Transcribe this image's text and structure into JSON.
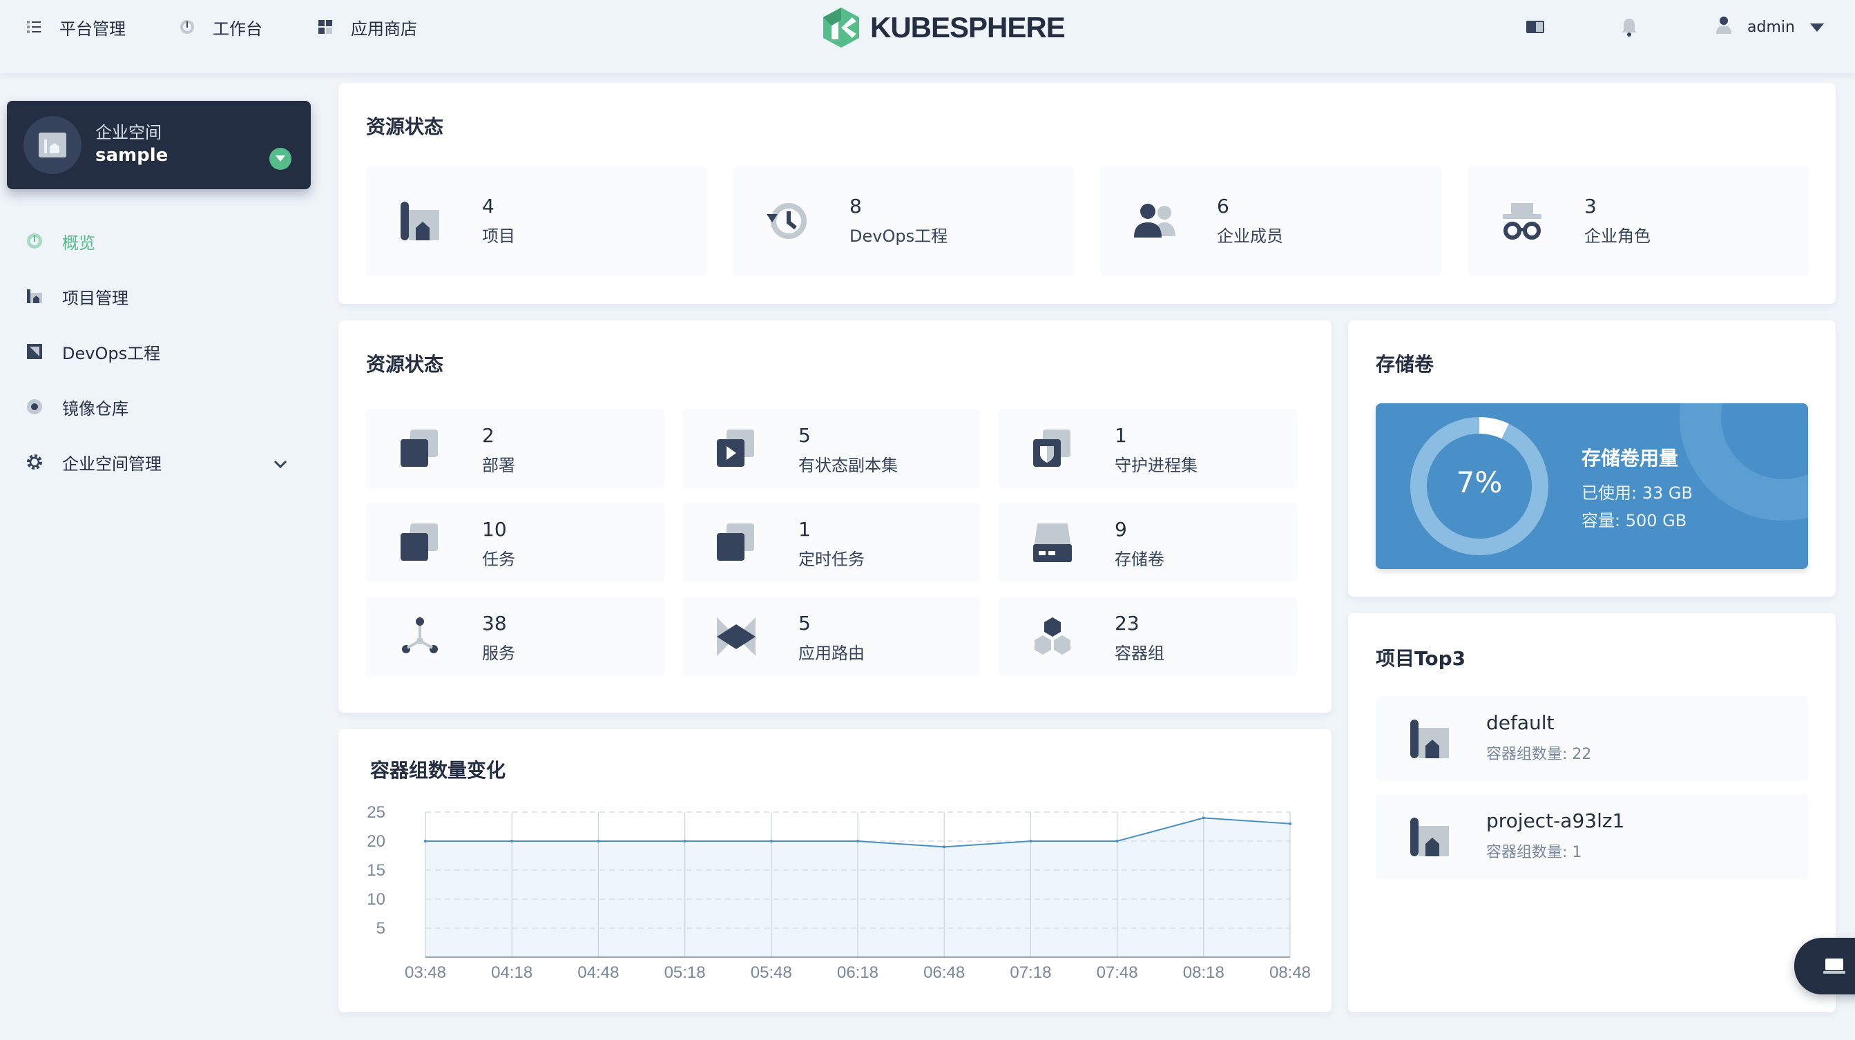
{
  "topbar": {
    "nav": [
      {
        "label": "平台管理",
        "icon": "platform-list-icon"
      },
      {
        "label": "工作台",
        "icon": "dashboard-gauge-icon"
      },
      {
        "label": "应用商店",
        "icon": "app-store-grid-icon"
      }
    ],
    "logo_text": "KUBESPHERE",
    "user": "admin"
  },
  "sidebar": {
    "workspace_label": "企业空间",
    "workspace_name": "sample",
    "items": [
      {
        "label": "概览",
        "icon": "overview-gauge-icon",
        "active": true
      },
      {
        "label": "项目管理",
        "icon": "project-icon"
      },
      {
        "label": "DevOps工程",
        "icon": "devops-icon"
      },
      {
        "label": "镜像仓库",
        "icon": "image-registry-icon"
      },
      {
        "label": "企业空间管理",
        "icon": "gear-icon"
      }
    ]
  },
  "resource_panel": {
    "title": "资源状态",
    "stats": [
      {
        "value": "4",
        "label": "项目",
        "icon": "project-icon"
      },
      {
        "value": "8",
        "label": "DevOps工程",
        "icon": "history-clock-icon"
      },
      {
        "value": "6",
        "label": "企业成员",
        "icon": "members-icon"
      },
      {
        "value": "3",
        "label": "企业角色",
        "icon": "role-spy-icon"
      }
    ]
  },
  "workload_panel": {
    "title": "资源状态",
    "stats": [
      {
        "value": "2",
        "label": "部署",
        "icon": "deployment-icon"
      },
      {
        "value": "5",
        "label": "有状态副本集",
        "icon": "statefulset-icon"
      },
      {
        "value": "1",
        "label": "守护进程集",
        "icon": "daemonset-icon"
      },
      {
        "value": "10",
        "label": "任务",
        "icon": "job-icon"
      },
      {
        "value": "1",
        "label": "定时任务",
        "icon": "cronjob-icon"
      },
      {
        "value": "9",
        "label": "存储卷",
        "icon": "volume-disk-icon"
      },
      {
        "value": "38",
        "label": "服务",
        "icon": "service-tree-icon"
      },
      {
        "value": "5",
        "label": "应用路由",
        "icon": "route-icon"
      },
      {
        "value": "23",
        "label": "容器组",
        "icon": "pods-hexagon-icon"
      }
    ]
  },
  "storage": {
    "title": "存储卷",
    "card_title": "存储卷用量",
    "percent_label": "7%",
    "percent": 7,
    "used": "已使用: 33 GB",
    "capacity": "容量: 500 GB"
  },
  "top3": {
    "title": "项目Top3",
    "items": [
      {
        "name": "default",
        "sub": "容器组数量: 22"
      },
      {
        "name": "project-a93lz1",
        "sub": "容器组数量: 1"
      }
    ]
  },
  "chart_title": "容器组数量变化",
  "chart_data": {
    "type": "area",
    "title": "容器组数量变化",
    "x": [
      "03:48",
      "04:18",
      "04:48",
      "05:18",
      "05:48",
      "06:18",
      "06:48",
      "07:18",
      "07:48",
      "08:18",
      "08:48"
    ],
    "series": [
      {
        "values": [
          20,
          20,
          20,
          20,
          20,
          20,
          19,
          20,
          20,
          24,
          23
        ]
      }
    ],
    "yticks": [
      "5",
      "10",
      "15",
      "20",
      "25"
    ],
    "ylim": [
      0,
      25
    ],
    "grid": true,
    "colors": {
      "line": "#4a90c8",
      "fill": "#eef5fb"
    }
  },
  "colors": {
    "accent_green": "#55bc8a",
    "dark": "#242e42",
    "storage_blue": "#4a90c8"
  }
}
